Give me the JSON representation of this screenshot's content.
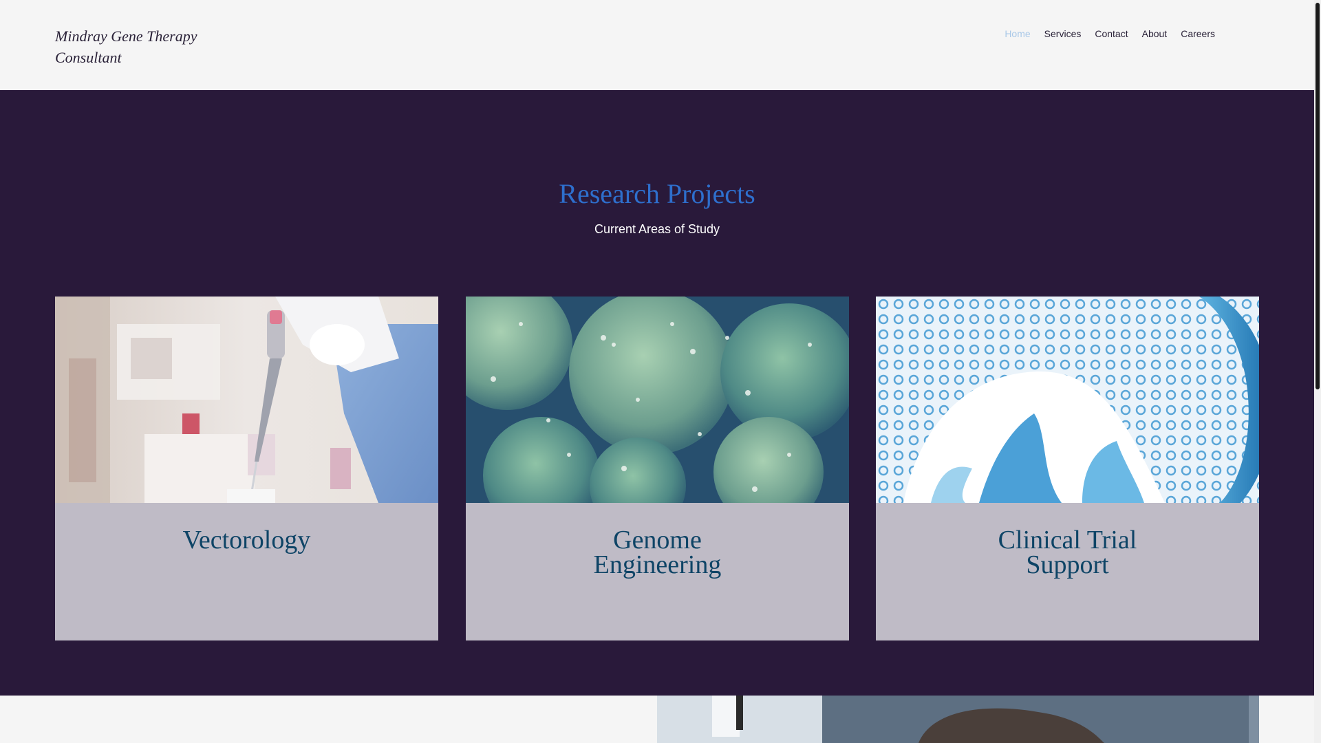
{
  "header": {
    "brand_line1": "Mindray Gene Therapy",
    "brand_line2": "Consultant",
    "nav": [
      "Home",
      "Services",
      "Contact",
      "About",
      "Careers"
    ],
    "active_nav": "Home"
  },
  "research": {
    "title": "Research Projects",
    "subtitle": "Current Areas of Study",
    "cards": [
      {
        "title_lines": [
          "Vectorology"
        ],
        "image": "lab-pipette-photo"
      },
      {
        "title_lines": [
          "Genome",
          "Engineering"
        ],
        "image": "cells-microscopy-photo"
      },
      {
        "title_lines": [
          "Clinical Trial",
          "Support"
        ],
        "image": "blue-culture-dish-photo"
      }
    ]
  },
  "colors": {
    "header_bg": "#f5f5f5",
    "section_bg": "#29193a",
    "title_blue": "#2e6fcd",
    "card_bg": "#bfbbc6",
    "card_title": "#0e4466",
    "nav_active": "#a9c8e8"
  }
}
